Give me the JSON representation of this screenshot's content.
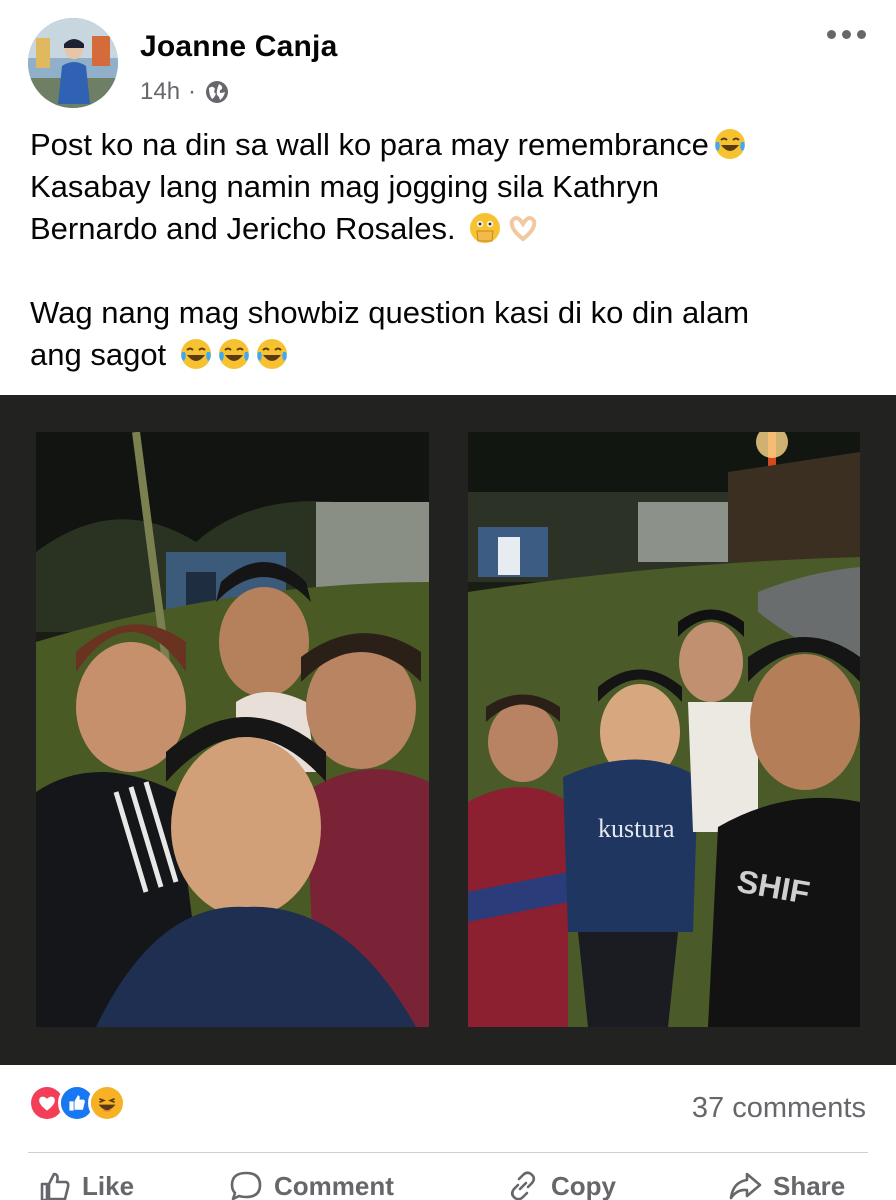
{
  "post": {
    "author": "Joanne Canja",
    "time": "14h",
    "separator": "·",
    "privacy_icon": "globe-icon",
    "text_lines": [
      "Post ko na din sa wall ko para may remembrance",
      "Kasabay lang namin mag jogging sila Kathryn",
      "Bernardo and Jericho Rosales.",
      "Wag nang mag showbiz question kasi di ko din alam",
      "ang sagot"
    ]
  },
  "photos": {
    "right_shirt_print": "kustura"
  },
  "reactions": {
    "icons": [
      "love-icon",
      "like-icon",
      "haha-icon"
    ],
    "comments_label": "37 comments"
  },
  "actions": {
    "like": "Like",
    "comment": "Comment",
    "copy": "Copy",
    "share": "Share"
  },
  "colors": {
    "accent_blue": "#1877f2",
    "love_red": "#f33e58",
    "haha_yellow": "#f7b125",
    "meta_gray": "#65676b",
    "photo_border": "#222320"
  }
}
